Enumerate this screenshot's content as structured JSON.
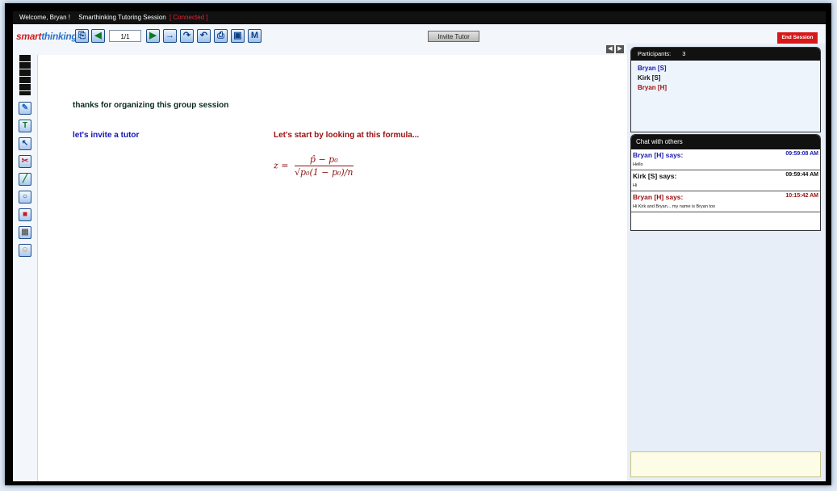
{
  "topbar": {
    "welcome": "Welcome, Bryan !",
    "session": "Smarthinking Tutoring Session",
    "status": "[ Connected ]"
  },
  "logo": {
    "part1": "smart",
    "part2": "thinking"
  },
  "toolbar": {
    "page_indicator": "1/1",
    "invite_label": "Invite Tutor",
    "end_label": "End Session",
    "m_label": "M"
  },
  "canvas": {
    "note1": "thanks for organizing this group session",
    "note2": "let's invite a tutor",
    "note3": "Let's start by looking at this formula...",
    "formula": {
      "lhs": "z =",
      "numerator": "p̂ − p₀",
      "denominator": "√p₀(1 − p₀)/n"
    }
  },
  "participants": {
    "label": "Participants:",
    "count": "3",
    "list": [
      "Bryan [S]",
      "Kirk [S]",
      "Bryan [H]"
    ]
  },
  "chat": {
    "title": "Chat with others",
    "messages": [
      {
        "who": "Bryan [H] says:",
        "time": "09:59:08 AM",
        "text": "Hello"
      },
      {
        "who": "Kirk [S] says:",
        "time": "09:59:44 AM",
        "text": "Hi"
      },
      {
        "who": "Bryan [H] says:",
        "time": "10:15:42 AM",
        "text": "Hi Kirk and Bryan... my name is Bryan too"
      }
    ]
  },
  "colors": {
    "student": "#1a1ab0",
    "host": "#9b0f0f",
    "note_dark": "#0a2a1c",
    "note_blue": "#1414b8",
    "note_red": "#9b0f0f"
  }
}
